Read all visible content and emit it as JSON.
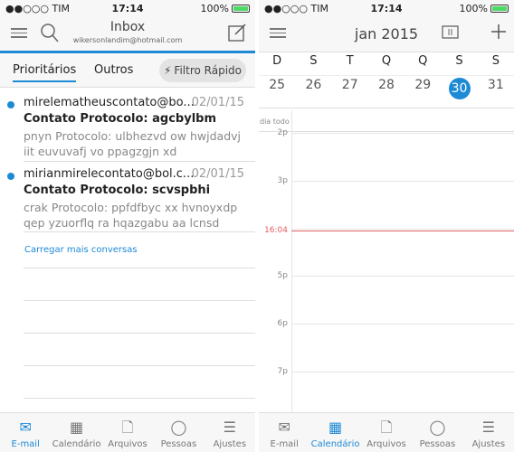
{
  "status": {
    "carrier": "●●○○○ TIM",
    "time": "17:14",
    "battery": "100%"
  },
  "email": {
    "header": {
      "title": "Inbox",
      "account": "wikersonlandim@hotmail.com"
    },
    "tabs": [
      "Prioritários",
      "Outros"
    ],
    "filter": "Filtro Rápido",
    "messages": [
      {
        "from": "mirelematheuscontato@bo...",
        "date": "02/01/15",
        "subject": "Contato Protocolo: agcbylbm",
        "preview": "pnyn Protocolo: ulbhezvd ow hwjdadvj iit euvuvafj vo ppagzgjn xd",
        "unread": true
      },
      {
        "from": "mirianmirelecontato@bol.c...",
        "date": "02/01/15",
        "subject": "Contato Protocolo: scvspbhi",
        "preview": "crak Protocolo: ppfdfbyc xx hvnoyxdp qep yzuorflq ra hqazgabu aa lcnsd",
        "unread": true
      }
    ],
    "load_more": "Carregar mais conversas"
  },
  "calendar": {
    "title": "jan 2015",
    "weekdays": [
      "D",
      "S",
      "T",
      "Q",
      "Q",
      "S",
      "S"
    ],
    "days": [
      "25",
      "26",
      "27",
      "28",
      "29",
      "30",
      "31"
    ],
    "selected_day": "30",
    "all_day": "dia todo",
    "hours": [
      "2p",
      "3p",
      "5p",
      "6p",
      "7p"
    ],
    "now": "16:04"
  },
  "tabbar": [
    "E-mail",
    "Calendário",
    "Arquivos",
    "Pessoas",
    "Ajustes"
  ],
  "colors": {
    "accent": "#1d8ad6",
    "now_line": "#e06060"
  }
}
